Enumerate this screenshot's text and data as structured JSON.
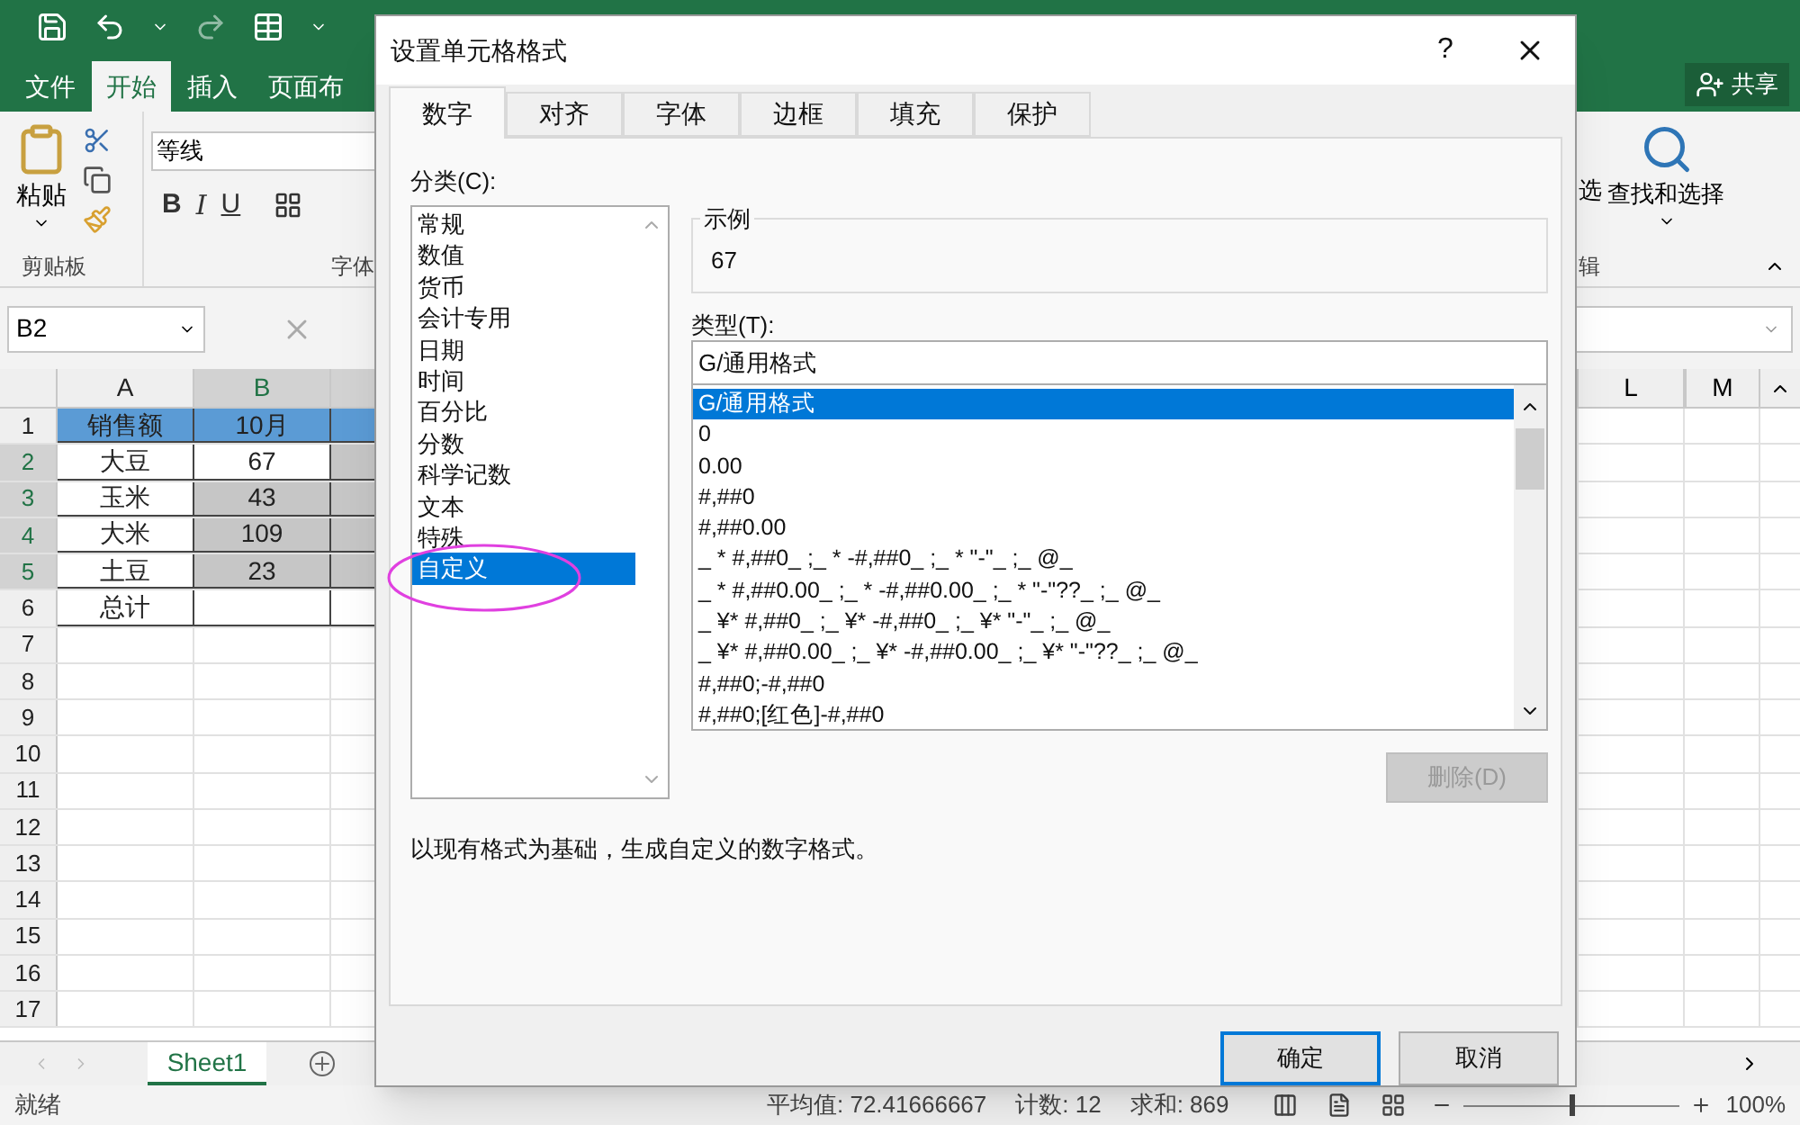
{
  "excel": {
    "tabs": [
      {
        "label": "文件",
        "selected": false
      },
      {
        "label": "开始",
        "selected": true
      },
      {
        "label": "插入",
        "selected": false
      },
      {
        "label": "页面布",
        "selected": false
      }
    ],
    "share": "共享",
    "ribbon": {
      "paste": "粘贴",
      "clipboard_group": "剪贴板",
      "font_name": "等线",
      "bold": "B",
      "italic": "I",
      "underline": "U",
      "font_group": "字体",
      "filter_cut": "选",
      "find_select": "查找和选择",
      "editing_group_cut": "辑"
    },
    "name_box": "B2",
    "columns": [
      {
        "label": "A",
        "selected": false
      },
      {
        "label": "B",
        "selected": true
      },
      {
        "selected": true
      }
    ],
    "right_columns": [
      "L",
      "M"
    ],
    "rows": [
      {
        "number": "1",
        "kind": "header",
        "selected": false,
        "cells": [
          "销售额",
          "10月"
        ]
      },
      {
        "number": "2",
        "kind": "data",
        "selected": true,
        "cells": [
          "大豆",
          "67"
        ]
      },
      {
        "number": "3",
        "kind": "data",
        "selected": true,
        "cells": [
          "玉米",
          "43"
        ]
      },
      {
        "number": "4",
        "kind": "data",
        "selected": true,
        "cells": [
          "大米",
          "109"
        ]
      },
      {
        "number": "5",
        "kind": "data",
        "selected": true,
        "cells": [
          "土豆",
          "23"
        ]
      },
      {
        "number": "6",
        "kind": "total",
        "selected": false,
        "cells": [
          "总计"
        ]
      },
      {
        "number": "7",
        "kind": "empty",
        "selected": false
      },
      {
        "number": "8",
        "kind": "empty",
        "selected": false
      },
      {
        "number": "9",
        "kind": "empty",
        "selected": false
      },
      {
        "number": "10",
        "kind": "empty",
        "selected": false
      },
      {
        "number": "11",
        "kind": "empty",
        "selected": false
      },
      {
        "number": "12",
        "kind": "empty",
        "selected": false
      },
      {
        "number": "13",
        "kind": "empty",
        "selected": false
      },
      {
        "number": "14",
        "kind": "empty",
        "selected": false
      },
      {
        "number": "15",
        "kind": "empty",
        "selected": false
      },
      {
        "number": "16",
        "kind": "empty",
        "selected": false
      },
      {
        "number": "17",
        "kind": "empty",
        "selected": false
      }
    ],
    "sheet_tab": "Sheet1",
    "status": "就绪",
    "stats": [
      "平均值: 72.41666667",
      "计数: 12",
      "求和: 869"
    ],
    "zoom_slider": {
      "level": 0.5
    },
    "zoom": "100%"
  },
  "dialog": {
    "title": "设置单元格格式",
    "help": "?",
    "tabs": [
      {
        "label": "数字",
        "selected": true
      },
      {
        "label": "对齐",
        "selected": false
      },
      {
        "label": "字体",
        "selected": false
      },
      {
        "label": "边框",
        "selected": false
      },
      {
        "label": "填充",
        "selected": false
      },
      {
        "label": "保护",
        "selected": false
      }
    ],
    "category_label": "分类(C):",
    "categories": [
      {
        "label": "常规",
        "selected": false
      },
      {
        "label": "数值",
        "selected": false
      },
      {
        "label": "货币",
        "selected": false
      },
      {
        "label": "会计专用",
        "selected": false
      },
      {
        "label": "日期",
        "selected": false
      },
      {
        "label": "时间",
        "selected": false
      },
      {
        "label": "百分比",
        "selected": false
      },
      {
        "label": "分数",
        "selected": false
      },
      {
        "label": "科学记数",
        "selected": false
      },
      {
        "label": "文本",
        "selected": false
      },
      {
        "label": "特殊",
        "selected": false
      },
      {
        "label": "自定义",
        "selected": true
      }
    ],
    "sample_label": "示例",
    "sample_value": "67",
    "type_label": "类型(T):",
    "type_value": "G/通用格式",
    "formats": [
      {
        "label": "G/通用格式",
        "selected": true
      },
      {
        "label": "0",
        "selected": false
      },
      {
        "label": "0.00",
        "selected": false
      },
      {
        "label": "#,##0",
        "selected": false
      },
      {
        "label": "#,##0.00",
        "selected": false
      },
      {
        "label": "_ * #,##0_ ;_ * -#,##0_ ;_ * \"-\"_ ;_ @_",
        "selected": false
      },
      {
        "label": "_ * #,##0.00_ ;_ * -#,##0.00_ ;_ * \"-\"??_ ;_ @_",
        "selected": false
      },
      {
        "label": "_ ¥* #,##0_ ;_ ¥* -#,##0_ ;_ ¥* \"-\"_ ;_ @_",
        "selected": false
      },
      {
        "label": "_ ¥* #,##0.00_ ;_ ¥* -#,##0.00_ ;_ ¥* \"-\"??_ ;_ @_",
        "selected": false
      },
      {
        "label": "#,##0;-#,##0",
        "selected": false
      },
      {
        "label": "#,##0;[红色]-#,##0",
        "selected": false
      }
    ],
    "delete_button": {
      "label": "删除(D)",
      "disabled": true
    },
    "description": "以现有格式为基础，生成自定义的数字格式。",
    "ok": "确定",
    "cancel": "取消"
  }
}
